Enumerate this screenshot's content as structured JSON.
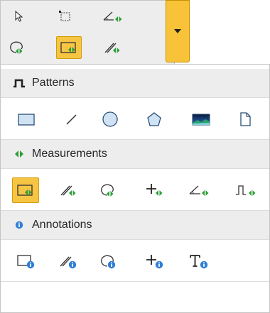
{
  "toolbar": {
    "top_row": [
      {
        "icon": "select-arrow-icon"
      },
      {
        "icon": "rectangle-select-icon"
      },
      {
        "icon": "angle-measure-icon"
      }
    ],
    "bottom_row": [
      {
        "icon": "freehand-region-measure-icon"
      },
      {
        "icon": "rectangle-measure-icon",
        "active": true
      },
      {
        "icon": "line-measure-icon"
      }
    ],
    "dropdown": {
      "icon": "chevron-down-icon",
      "color": "#f8c338"
    }
  },
  "sections": {
    "patterns": {
      "label": "Patterns",
      "icon": "pulse-pattern-icon",
      "tools": [
        "rectangle-pattern-icon",
        "line-pattern-icon",
        "circle-pattern-icon",
        "polygon-pattern-icon",
        "image-pattern-icon",
        "file-pattern-icon"
      ]
    },
    "measurements": {
      "label": "Measurements",
      "icon": "measure-arrows-icon",
      "tools": [
        "rectangle-measure-icon",
        "line-measure-icon",
        "freehand-region-measure-icon",
        "crosshair-measure-icon",
        "angle-measure-icon",
        "pulse-measure-icon"
      ],
      "active_index": 0
    },
    "annotations": {
      "label": "Annotations",
      "icon": "info-icon",
      "tools": [
        "rectangle-annotation-icon",
        "line-annotation-icon",
        "freehand-annotation-icon",
        "crosshair-annotation-icon",
        "text-annotation-icon"
      ]
    }
  },
  "colors": {
    "active": "#f7c544",
    "measure_green": "#2f9e3b",
    "annotation_blue": "#2f7fd6",
    "pattern_fill": "#cfe3f5",
    "pattern_stroke": "#2a4e73"
  }
}
